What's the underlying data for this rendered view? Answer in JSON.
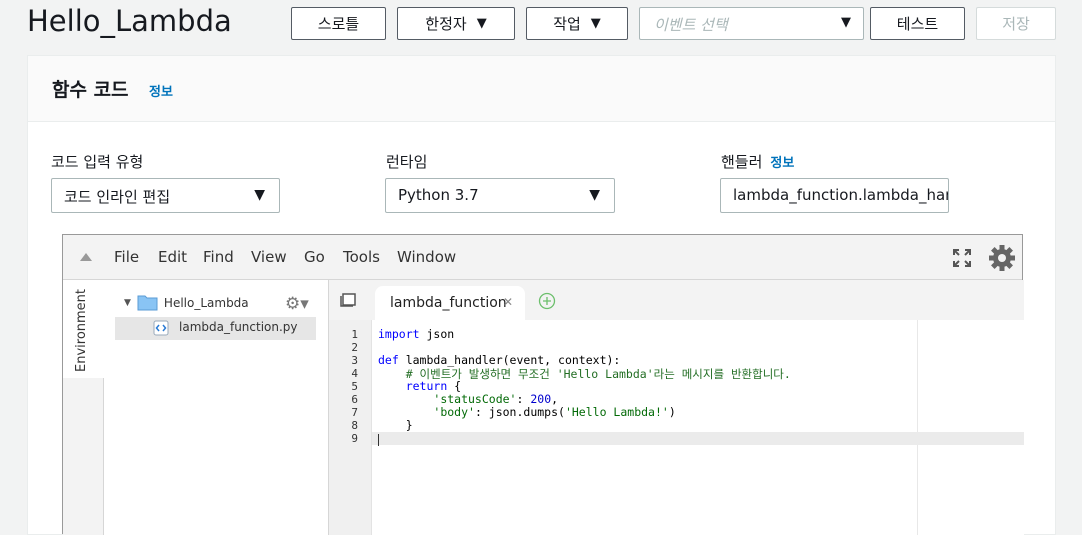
{
  "header": {
    "function_name": "Hello_Lambda",
    "buttons": {
      "throttle": "스로틀",
      "qualifiers": "한정자",
      "actions": "작업",
      "test": "테스트",
      "save": "저장"
    },
    "event_select_placeholder": "이벤트 선택"
  },
  "panel": {
    "title": "함수 코드",
    "info": "정보",
    "code_entry_type": {
      "label": "코드 입력 유형",
      "value": "코드 인라인 편집"
    },
    "runtime": {
      "label": "런타임",
      "value": "Python 3.7"
    },
    "handler": {
      "label": "핸들러",
      "info": "정보",
      "value": "lambda_function.lambda_handler"
    }
  },
  "ide": {
    "menu": [
      "File",
      "Edit",
      "Find",
      "View",
      "Go",
      "Tools",
      "Window"
    ],
    "environment_tab": "Environment",
    "tree": {
      "root": "Hello_Lambda",
      "file": "lambda_function.py"
    },
    "tab_label": "lambda_function",
    "line_numbers": [
      "1",
      "2",
      "3",
      "4",
      "5",
      "6",
      "7",
      "8",
      "9"
    ],
    "code": {
      "l1_kw": "import",
      "l1_rest": " json",
      "l3_kw": "def",
      "l3_rest": " lambda_handler(event, context):",
      "l4": "    # 이벤트가 발생하면 무조건 'Hello Lambda'라는 메시지를 반환합니다.",
      "l5_kw": "return",
      "l5_rest": " {",
      "l6_key": "'statusCode'",
      "l6_sep": ": ",
      "l6_num": "200",
      "l6_end": ",",
      "l7_key": "'body'",
      "l7_mid": ": json.dumps(",
      "l7_str": "'Hello Lambda!'",
      "l7_end": ")",
      "l8": "    }"
    }
  },
  "colors": {
    "link": "#0073bb",
    "keyword": "#0000ff",
    "comment": "#236e24",
    "string": "#036a07"
  }
}
